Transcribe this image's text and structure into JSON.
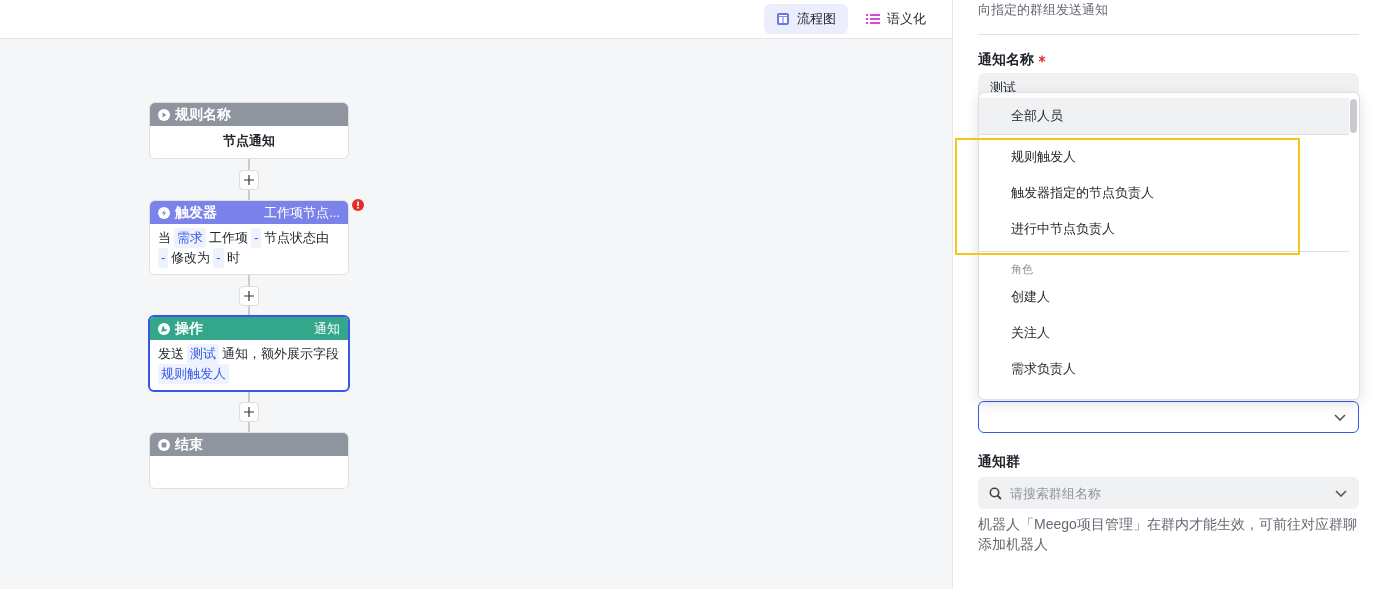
{
  "toolbar": {
    "view_tabs": [
      {
        "label": "流程图",
        "selected": true
      },
      {
        "label": "语义化",
        "selected": false
      }
    ]
  },
  "flow": {
    "nodes": [
      {
        "kind": "start",
        "title": "规则名称",
        "content": [
          {
            "text": "节点通知",
            "tag": false
          }
        ],
        "selected": false,
        "warning": false
      },
      {
        "kind": "trigger",
        "title": "触发器",
        "tag_text": "工作项节点...",
        "content": [
          {
            "text": "当",
            "tag": false
          },
          {
            "text": "需求",
            "tag": true
          },
          {
            "text": "工作项",
            "tag": false
          },
          {
            "text": "-",
            "tag": true
          },
          {
            "text": "节点状态由",
            "tag": false
          },
          {
            "text": "-",
            "tag": true
          },
          {
            "text": "修改为",
            "tag": false
          },
          {
            "text": "-",
            "tag": true
          },
          {
            "text": "时",
            "tag": false
          }
        ],
        "selected": false,
        "warning": true
      },
      {
        "kind": "action",
        "title": "操作",
        "tag_text": "通知",
        "content": [
          {
            "text": "发送",
            "tag": false
          },
          {
            "text": "测试",
            "tag": true
          },
          {
            "text": "通知，额外展示字段",
            "tag": false
          },
          {
            "text": "规则触发人",
            "tag": true
          }
        ],
        "selected": true,
        "warning": false
      },
      {
        "kind": "end",
        "title": "结束",
        "selected": false,
        "warning": false
      }
    ]
  },
  "panel": {
    "description": "向指定的群组发送通知",
    "name_field": {
      "label": "通知名称",
      "required": true,
      "value": "测试"
    },
    "dropdown": {
      "groups": [
        {
          "items": [
            {
              "label": "全部人员",
              "selected": true
            }
          ]
        },
        {
          "items": [
            {
              "label": "规则触发人",
              "selected": false
            },
            {
              "label": "触发器指定的节点负责人",
              "selected": false
            },
            {
              "label": "进行中节点负责人",
              "selected": false
            }
          ]
        },
        {
          "label": "角色",
          "items": [
            {
              "label": "创建人",
              "selected": false
            },
            {
              "label": "关注人",
              "selected": false
            },
            {
              "label": "需求负责人",
              "selected": false
            }
          ]
        }
      ]
    },
    "people_select": {
      "focused": true
    },
    "group_field": {
      "label": "通知群",
      "placeholder": "请搜索群组名称"
    },
    "hint": "机器人「Meego项目管理」在群内才能生效，可前往对应群聊添加机器人"
  }
}
